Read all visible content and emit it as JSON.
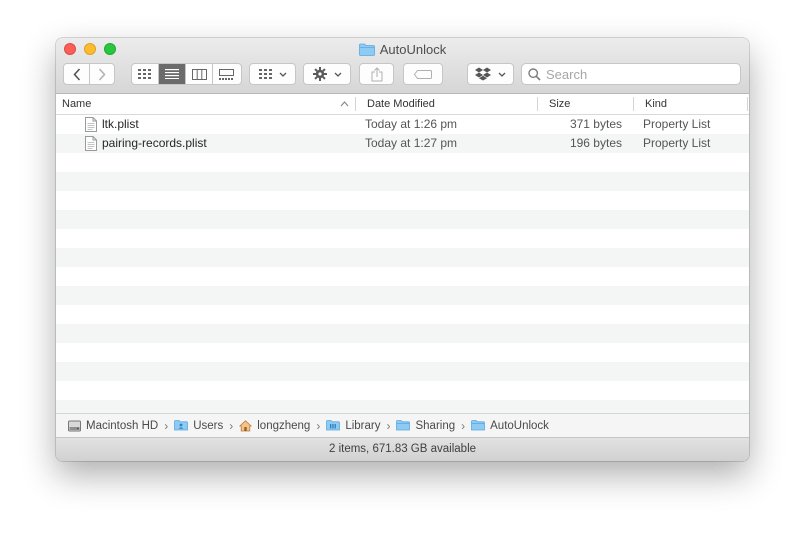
{
  "window": {
    "title": "AutoUnlock"
  },
  "toolbar": {
    "search_placeholder": "Search"
  },
  "columns": {
    "name": "Name",
    "date_modified": "Date Modified",
    "size": "Size",
    "kind": "Kind"
  },
  "files": [
    {
      "name": "ltk.plist",
      "date_modified": "Today at 1:26 pm",
      "size": "371 bytes",
      "kind": "Property List"
    },
    {
      "name": "pairing-records.plist",
      "date_modified": "Today at 1:27 pm",
      "size": "196 bytes",
      "kind": "Property List"
    }
  ],
  "path": [
    "Macintosh HD",
    "Users",
    "longzheng",
    "Library",
    "Sharing",
    "AutoUnlock"
  ],
  "status": "2 items, 671.83 GB available",
  "colors": {
    "folder": "#6cb8ef",
    "selected_view": "#6b6b6b"
  }
}
